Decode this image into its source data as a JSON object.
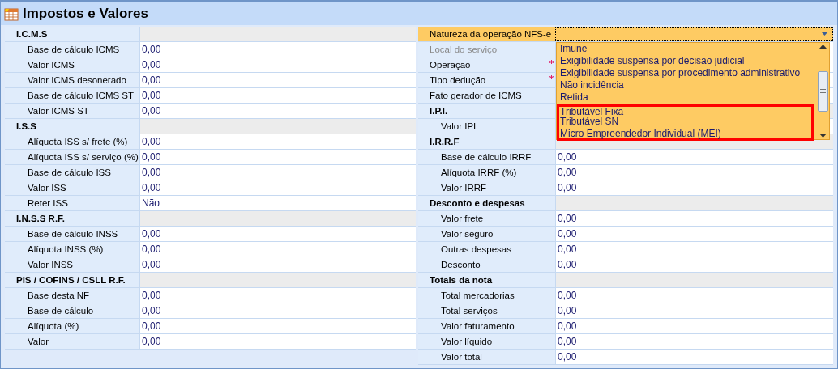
{
  "title": "Impostos e Valores",
  "left_sections": [
    {
      "title": "I.C.M.S",
      "rows": [
        {
          "label": "Base de cálculo ICMS",
          "value": "0,00"
        },
        {
          "label": "Valor ICMS",
          "value": "0,00"
        },
        {
          "label": "Valor ICMS desonerado",
          "value": "0,00"
        },
        {
          "label": "Base de cálculo ICMS ST",
          "value": "0,00"
        },
        {
          "label": "Valor ICMS ST",
          "value": "0,00"
        }
      ]
    },
    {
      "title": "I.S.S",
      "rows": [
        {
          "label": "Alíquota ISS s/ frete (%)",
          "value": "0,00"
        },
        {
          "label": "Alíquota ISS s/ serviço (%)",
          "value": "0,00"
        },
        {
          "label": "Base de cálculo ISS",
          "value": "0,00"
        },
        {
          "label": "Valor ISS",
          "value": "0,00"
        },
        {
          "label": "Reter ISS",
          "value": "Não"
        }
      ]
    },
    {
      "title": "I.N.S.S R.F.",
      "rows": [
        {
          "label": "Base de cálculo INSS",
          "value": "0,00"
        },
        {
          "label": "Alíquota INSS (%)",
          "value": "0,00"
        },
        {
          "label": "Valor INSS",
          "value": "0,00"
        }
      ]
    },
    {
      "title": "PIS / COFINS / CSLL R.F.",
      "rows": [
        {
          "label": "Base desta NF",
          "value": "0,00"
        },
        {
          "label": "Base de cálculo",
          "value": "0,00"
        },
        {
          "label": "Alíquota (%)",
          "value": "0,00"
        },
        {
          "label": "Valor",
          "value": "0,00"
        }
      ]
    }
  ],
  "right_fields": [
    {
      "label": "Natureza da operação NFS-e",
      "selected": true,
      "disabled": false,
      "required": false,
      "expanded": true
    },
    {
      "label": "Local do serviço",
      "selected": false,
      "disabled": true,
      "required": false
    },
    {
      "label": "Operação",
      "selected": false,
      "disabled": false,
      "required": true
    },
    {
      "label": "Tipo dedução",
      "selected": false,
      "disabled": false,
      "required": true
    },
    {
      "label": "Fato gerador de ICMS",
      "selected": false,
      "disabled": false,
      "required": false
    }
  ],
  "right_sections": [
    {
      "title": "I.P.I.",
      "rows": [
        {
          "label": "Valor IPI"
        }
      ]
    },
    {
      "title": "I.R.R.F",
      "rows": [
        {
          "label": "Base de cálculo IRRF",
          "value": "0,00"
        },
        {
          "label": "Alíquota IRRF (%)",
          "value": "0,00"
        },
        {
          "label": "Valor IRRF",
          "value": "0,00"
        }
      ]
    },
    {
      "title": "Desconto e despesas",
      "rows": [
        {
          "label": "Valor frete",
          "value": "0,00"
        },
        {
          "label": "Valor seguro",
          "value": "0,00"
        },
        {
          "label": "Outras despesas",
          "value": "0,00"
        },
        {
          "label": "Desconto",
          "value": "0,00"
        }
      ]
    },
    {
      "title": "Totais da nota",
      "rows": [
        {
          "label": "Total mercadorias",
          "value": "0,00"
        },
        {
          "label": "Total serviços",
          "value": "0,00"
        },
        {
          "label": "Valor faturamento",
          "value": "0,00"
        },
        {
          "label": "Valor líquido",
          "value": "0,00"
        },
        {
          "label": "Valor total",
          "value": "0,00"
        }
      ]
    }
  ],
  "dropdown_options": [
    {
      "label": "Imune",
      "annotated": false
    },
    {
      "label": "Exigibilidade suspensa por decisão judicial",
      "annotated": false
    },
    {
      "label": "Exigibilidade suspensa por procedimento administrativo",
      "annotated": false
    },
    {
      "label": "Não incidência",
      "annotated": false
    },
    {
      "label": "Retida",
      "annotated": false
    },
    {
      "label": "Tributável Fixa",
      "annotated": true
    },
    {
      "label": "Tributável SN",
      "annotated": true
    },
    {
      "label": "Micro Empreendedor Individual (MEI)",
      "annotated": true
    }
  ]
}
